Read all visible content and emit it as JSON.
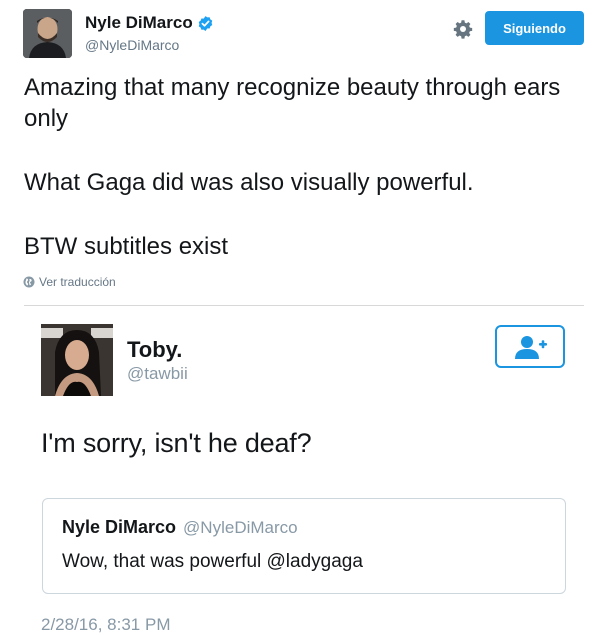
{
  "main_tweet": {
    "author": {
      "name": "Nyle DiMarco",
      "handle": "@NyleDiMarco",
      "verified": true
    },
    "follow_button_label": "Siguiendo",
    "text": [
      "Amazing that many recognize beauty through ears only",
      "What Gaga did was also visually powerful.",
      "BTW subtitles exist"
    ],
    "translate_label": "Ver traducción"
  },
  "embedded_tweet": {
    "author": {
      "name": "Toby.",
      "handle": "@tawbii"
    },
    "text": "I'm sorry, isn't he deaf?",
    "quoted": {
      "name": "Nyle DiMarco",
      "handle": "@NyleDiMarco",
      "text": "Wow, that was powerful @ladygaga"
    },
    "timestamp": "2/28/16, 8:31 PM"
  },
  "icons": {
    "verified": "verified-badge-icon",
    "settings": "gear-icon",
    "translate": "globe-icon",
    "follow": "add-user-icon"
  },
  "colors": {
    "accent": "#1b95e0",
    "text": "#14171a",
    "secondary": "#657786",
    "muted": "#8899a6",
    "border": "#ccd6dd"
  }
}
